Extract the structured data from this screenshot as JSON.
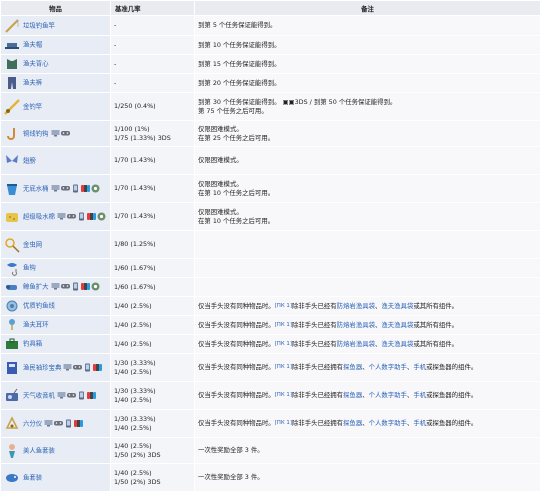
{
  "header": {
    "item": "物品",
    "rate": "基准几率",
    "note": "备注"
  },
  "plat_icons": {
    "pc": "pc-icon",
    "console": "console-icon",
    "mobile": "mobile-icon",
    "switch": "switch-icon",
    "3ds": "3ds-icon",
    "tml": "tmodloader-icon"
  },
  "colors": {
    "link": "#2c63b8",
    "header_bg": "#e9ebf1",
    "item_bg": "#e8ecf4"
  },
  "rows": [
    {
      "name": "垃圾钓鱼竿",
      "icon": "fishing-rod-icon",
      "plats": [],
      "rate": [
        "-"
      ],
      "note": [
        "到第 5 个任务保证能得到。"
      ],
      "h": 20
    },
    {
      "name": "渔夫帽",
      "icon": "hat-icon",
      "plats": [],
      "rate": [
        "-"
      ],
      "note": [
        "到第 10 个任务保证能得到。"
      ],
      "h": 16
    },
    {
      "name": "渔夫背心",
      "icon": "vest-icon",
      "plats": [],
      "rate": [
        "-"
      ],
      "note": [
        "到第 15 个任务保证能得到。"
      ],
      "h": 16
    },
    {
      "name": "渔夫裤",
      "icon": "pants-icon",
      "plats": [],
      "rate": [
        "-"
      ],
      "note": [
        "到第 20 个任务保证能得到。"
      ],
      "h": 16
    },
    {
      "name": "金钓竿",
      "icon": "golden-rod-icon",
      "plats": [],
      "rate": [
        "1/250 (0.4%)"
      ],
      "note": [
        "到第 30 个任务保证能得到。 ▣▣3DS / 到第 50 个任务保证能得到。",
        "第 75 个任务之后可用。"
      ],
      "h": 28
    },
    {
      "name": "铜线钓钩",
      "icon": "hook-icon",
      "plats": [
        "pc",
        "console"
      ],
      "rate": [
        "1/100 (1%)",
        "1/75 (1.33%) 3DS"
      ],
      "note": [
        "仅限困难模式。",
        "在第 25 个任务之后可用。"
      ],
      "h": 26
    },
    {
      "name": "翅膀",
      "icon": "wings-icon",
      "plats": [],
      "rate": [
        "1/70 (1.43%)"
      ],
      "note": [
        "仅限困难模式。"
      ],
      "h": 28
    },
    {
      "name": "无底水桶",
      "icon": "bucket-icon",
      "plats": [
        "pc",
        "console",
        "mobile",
        "switch",
        "tml"
      ],
      "rate": [
        "1/70 (1.43%)"
      ],
      "note": [
        "仅限困难模式。",
        "在第 10 个任务之后可用。"
      ],
      "h": 28
    },
    {
      "name": "超级吸水棉",
      "icon": "sponge-icon",
      "plats": [
        "pc",
        "console",
        "mobile",
        "switch",
        "tml"
      ],
      "rate": [
        "1/70 (1.43%)"
      ],
      "note": [
        "仅限困难模式。",
        "在第 10 个任务之后可用。"
      ],
      "h": 28
    },
    {
      "name": "金虫网",
      "icon": "net-icon",
      "plats": [],
      "rate": [
        "1/80 (1.25%)"
      ],
      "note": [
        ""
      ],
      "h": 28
    },
    {
      "name": "鱼钩",
      "icon": "fish-hook-icon",
      "plats": [],
      "rate": [
        "1/60 (1.67%)"
      ],
      "note": [
        ""
      ],
      "h": 18
    },
    {
      "name": "鲸鱼扩大",
      "icon": "tool-icon",
      "plats": [
        "pc",
        "console",
        "mobile",
        "switch",
        "tml"
      ],
      "rate": [
        "1/60 (1.67%)"
      ],
      "note": [
        ""
      ],
      "h": 16
    },
    {
      "name": "优质钓鱼线",
      "icon": "line-icon",
      "plats": [],
      "rate": [
        "1/40 (2.5%)"
      ],
      "note_html": "仅当手头没有同种物品时。<span class='tag'>[ПК 1]</span>除非手头已经有<span class='lnk'>防熔岩渔具袋</span>、<span class='lnk'>渔夫渔具袋</span>或其所有组件。",
      "h": 18
    },
    {
      "name": "渔夫耳环",
      "icon": "earring-icon",
      "plats": [],
      "rate": [
        "1/40 (2.5%)"
      ],
      "note_html": "仅当手头没有同种物品时。<span class='tag'>[ПК 1]</span>除非手头已经有<span class='lnk'>防熔岩渔具袋</span>、<span class='lnk'>渔夫渔具袋</span>或其所有组件。",
      "h": 18
    },
    {
      "name": "钓具箱",
      "icon": "tackle-box-icon",
      "plats": [],
      "rate": [
        "1/40 (2.5%)"
      ],
      "note_html": "仅当手头没有同种物品时。<span class='tag'>[ПК 1]</span>除非手头已经有<span class='lnk'>防熔岩渔具袋</span>、<span class='lnk'>渔夫渔具袋</span>或其所有组件。",
      "h": 18
    },
    {
      "name": "渔民袖珍宝典",
      "icon": "guide-icon",
      "plats": [
        "pc",
        "console",
        "mobile",
        "switch"
      ],
      "rate": [
        "1/30 (3.33%)",
        "1/40 (2.5%)"
      ],
      "note_html": "仅当手头没有同种物品时。<span class='tag'>[ПК 1]</span>除非手头已经拥有<span class='lnk'>探鱼器</span>、<span class='lnk'>个人数字助手</span>、<span class='lnk'>手机</span>或探鱼器的组件。",
      "h": 28
    },
    {
      "name": "天气收音机",
      "icon": "radio-icon",
      "plats": [
        "pc",
        "console",
        "mobile",
        "switch"
      ],
      "rate": [
        "1/30 (3.33%)",
        "1/40 (2.5%)"
      ],
      "note_html": "仅当手头没有同种物品时。<span class='tag'>[ПК 1]</span>除非手头已经拥有<span class='lnk'>探鱼器</span>、<span class='lnk'>个人数字助手</span>、<span class='lnk'>手机</span>或探鱼器的组件。",
      "h": 28
    },
    {
      "name": "六分仪",
      "icon": "sextant-icon",
      "plats": [
        "pc",
        "console",
        "mobile",
        "switch"
      ],
      "rate": [
        "1/30 (3.33%)",
        "1/40 (2.5%)"
      ],
      "note_html": "仅当手头没有同种物品时。<span class='tag'>[ПК 1]</span>除非手头已经拥有<span class='lnk'>探鱼器</span>、<span class='lnk'>个人数字助手</span>、<span class='lnk'>手机</span>或探鱼器的组件。",
      "h": 28
    },
    {
      "name": "美人鱼套装",
      "icon": "mermaid-icon",
      "plats": [],
      "rate": [
        "1/40 (2.5%)",
        "1/50 (2%) 3DS"
      ],
      "note": [
        "一次性奖励全部 3 件。"
      ],
      "h": 26
    },
    {
      "name": "鱼套装",
      "icon": "fish-costume-icon",
      "plats": [],
      "rate": [
        "1/40 (2.5%)",
        "1/50 (2%) 3DS"
      ],
      "note": [
        "一次性奖励全部 3 件。"
      ],
      "h": 28
    }
  ]
}
